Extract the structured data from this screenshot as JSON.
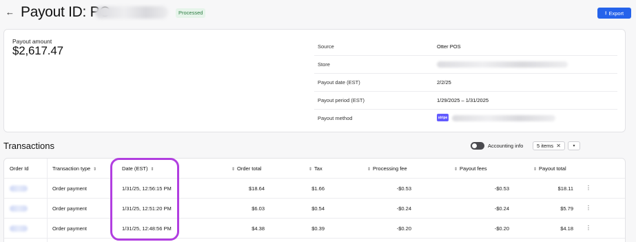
{
  "header": {
    "back_icon": "←",
    "title": "Payout ID: PO-",
    "status": "Processed",
    "export_label": "Export",
    "export_icon": "⭳"
  },
  "summary": {
    "amount_label": "Payout amount",
    "amount_value": "$2,617.47",
    "details": [
      {
        "label": "Source",
        "value": "Otter POS"
      },
      {
        "label": "Store",
        "value": ""
      },
      {
        "label": "Payout date (EST)",
        "value": "2/2/25"
      },
      {
        "label": "Payout period (EST)",
        "value": "1/29/2025 – 1/31/2025"
      },
      {
        "label": "Payout method",
        "value": "",
        "logo": "stripe"
      }
    ]
  },
  "transactions": {
    "title": "Transactions",
    "accounting_info_label": "Accounting info",
    "accounting_info_on": false,
    "items_chip": "5 items",
    "columns": [
      "Order Id",
      "Transaction type",
      "Date (EST)",
      "Order total",
      "Tax",
      "Processing fee",
      "Payout fees",
      "Payout total"
    ],
    "rows": [
      {
        "order_id": "",
        "type": "Order payment",
        "date": "1/31/25, 12:56:15 PM",
        "order_total": "$18.64",
        "tax": "$1.66",
        "processing_fee": "-$0.53",
        "payout_fees": "-$0.53",
        "payout_total": "$18.11"
      },
      {
        "order_id": "",
        "type": "Order payment",
        "date": "1/31/25, 12:51:20 PM",
        "order_total": "$6.03",
        "tax": "$0.54",
        "processing_fee": "-$0.24",
        "payout_fees": "-$0.24",
        "payout_total": "$5.79"
      },
      {
        "order_id": "",
        "type": "Order payment",
        "date": "1/31/25, 12:48:56 PM",
        "order_total": "$4.38",
        "tax": "$0.39",
        "processing_fee": "-$0.20",
        "payout_fees": "-$0.20",
        "payout_total": "$4.18"
      }
    ]
  },
  "colors": {
    "accent": "#2563eb",
    "status_bg": "#e6f4ea",
    "status_text": "#2e7d43",
    "highlight": "#b13ee0"
  }
}
